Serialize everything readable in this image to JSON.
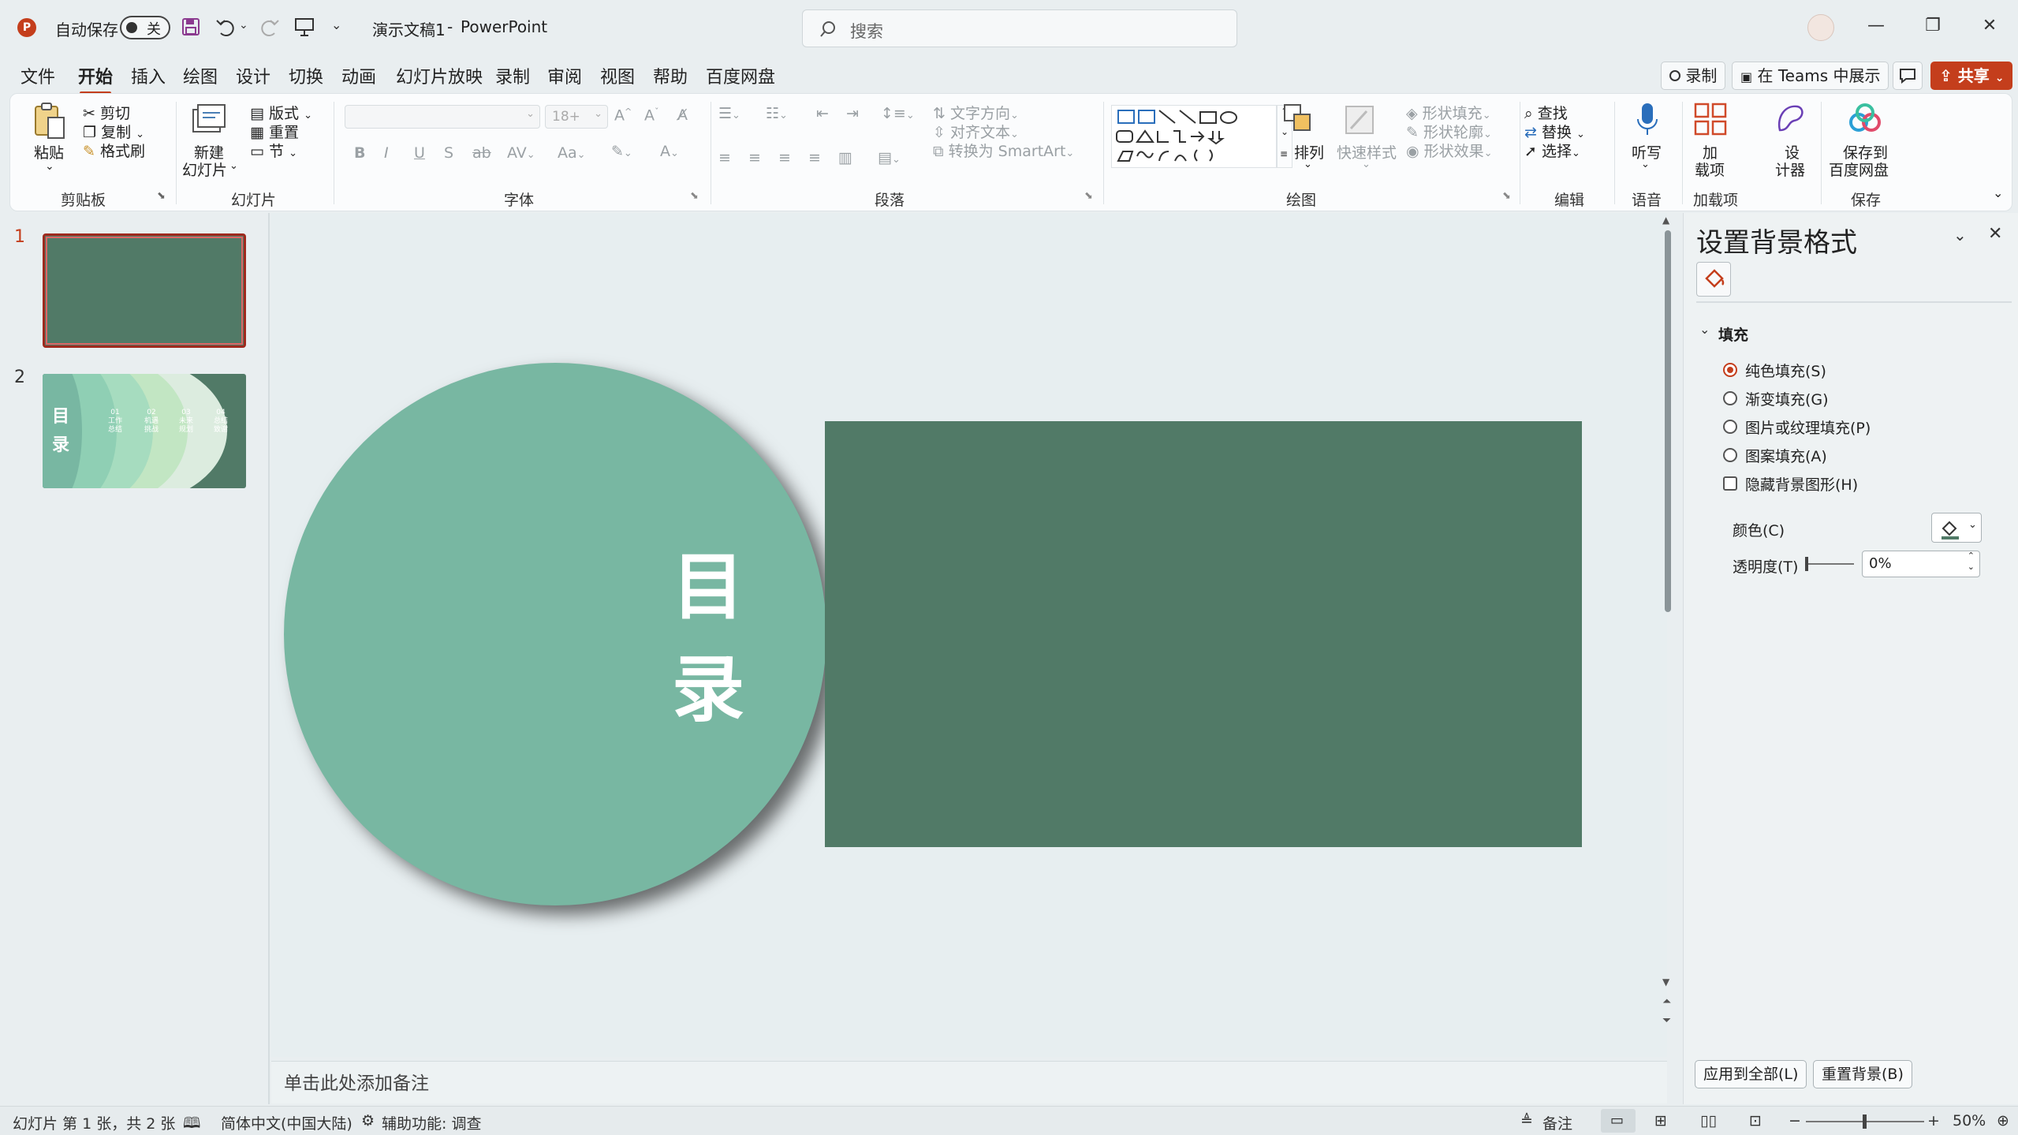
{
  "titlebar": {
    "autosave_label": "自动保存",
    "autosave_state": "关",
    "doc_title": "演示文稿1",
    "separator": "-",
    "app_name": "PowerPoint",
    "search_placeholder": "搜索"
  },
  "tabs": [
    "文件",
    "开始",
    "插入",
    "绘图",
    "设计",
    "切换",
    "动画",
    "幻灯片放映",
    "录制",
    "审阅",
    "视图",
    "帮助",
    "百度网盘"
  ],
  "active_tab": "开始",
  "top_buttons": {
    "record": "录制",
    "teams": "在 Teams 中展示",
    "share": "共享"
  },
  "ribbon": {
    "clipboard": {
      "paste": "粘贴",
      "cut": "剪切",
      "copy": "复制",
      "format_painter": "格式刷",
      "label": "剪贴板"
    },
    "slides": {
      "new_slide_1": "新建",
      "new_slide_2": "幻灯片",
      "layout": "版式",
      "reset": "重置",
      "section": "节",
      "label": "幻灯片"
    },
    "font": {
      "font_name": "",
      "font_size": "18+",
      "bold": "B",
      "italic": "I",
      "underline": "U",
      "shadow": "S",
      "strike": "ab",
      "spacing": "AV",
      "case": "Aa",
      "label": "字体"
    },
    "paragraph": {
      "text_direction": "文字方向",
      "align_text": "对齐文本",
      "smartart": "转换为 SmartArt",
      "label": "段落"
    },
    "drawing": {
      "arrange": "排列",
      "quick_styles": "快速样式",
      "shape_fill": "形状填充",
      "shape_outline": "形状轮廓",
      "shape_effects": "形状效果",
      "label": "绘图"
    },
    "editing": {
      "find": "查找",
      "replace": "替换",
      "select": "选择",
      "label": "编辑"
    },
    "voice": {
      "dictate": "听写",
      "label": "语音"
    },
    "addins": {
      "addins_1": "加",
      "addins_2": "载项",
      "label": "加载项"
    },
    "designer": {
      "designer_1": "设",
      "designer_2": "计器"
    },
    "save": {
      "save_1": "保存到",
      "save_2": "百度网盘",
      "label": "保存"
    }
  },
  "thumbnails": [
    {
      "number": "1"
    },
    {
      "number": "2",
      "title_chars": [
        "目",
        "录"
      ],
      "items": [
        {
          "num": "01",
          "l1": "工作",
          "l2": "总结"
        },
        {
          "num": "02",
          "l1": "机遇",
          "l2": "挑战"
        },
        {
          "num": "03",
          "l1": "未来",
          "l2": "规划"
        },
        {
          "num": "04",
          "l1": "总结",
          "l2": "致谢"
        }
      ]
    }
  ],
  "slide": {
    "title_char_1": "目",
    "title_char_2": "录",
    "circle_color": "#78b7a2",
    "rect_color": "#517a67"
  },
  "notes_placeholder": "单击此处添加备注",
  "pane": {
    "title": "设置背景格式",
    "section": "填充",
    "options": [
      "纯色填充(S)",
      "渐变填充(G)",
      "图片或纹理填充(P)",
      "图案填充(A)"
    ],
    "selected_option": "纯色填充(S)",
    "hide_bg": "隐藏背景图形(H)",
    "color_label": "颜色(C)",
    "transparency_label": "透明度(T)",
    "transparency_value": "0%",
    "apply_all": "应用到全部(L)",
    "reset_bg": "重置背景(B)"
  },
  "status": {
    "slide_info": "幻灯片 第 1 张，共 2 张",
    "language": "简体中文(中国大陆)",
    "accessibility": "辅助功能: 调查",
    "notes": "备注",
    "zoom": "50%"
  },
  "colors": {
    "accent": "#c43e1c",
    "slide_dark": "#517a67",
    "slide_circle": "#78b7a2"
  }
}
